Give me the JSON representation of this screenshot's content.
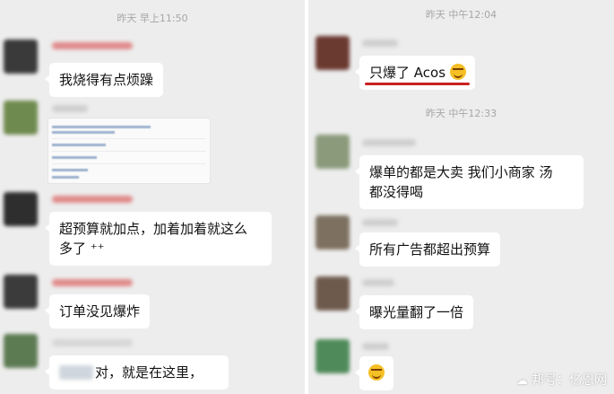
{
  "left": {
    "timestamp": "昨天 早上11:50",
    "messages": [
      {
        "text": "我烧得有点烦躁"
      },
      {
        "text": ""
      },
      {
        "text_line1": "超预算就加点，加着加着就这么",
        "text_line2": "多了 ⁺⁺"
      },
      {
        "text": "订单没见爆炸"
      },
      {
        "text": "对，就是在这里，"
      }
    ]
  },
  "right": {
    "timestamp1": "昨天 中午12:04",
    "timestamp2": "昨天 中午12:33",
    "messages": [
      {
        "text": "只爆了 Acos"
      },
      {
        "text_line1": "爆单的都是大卖  我们小商家  汤",
        "text_line2": "都没得喝"
      },
      {
        "text": "所有广告都超出预算"
      },
      {
        "text": "曝光量翻了一倍"
      },
      {
        "text": ""
      }
    ]
  },
  "watermark": {
    "icon": "wechat-icon",
    "text": "邦号：亿恩网"
  },
  "colors": {
    "background": "#ededed",
    "bubble": "#ffffff",
    "underline": "#c9221f",
    "timestamp": "#a6a6a6"
  }
}
